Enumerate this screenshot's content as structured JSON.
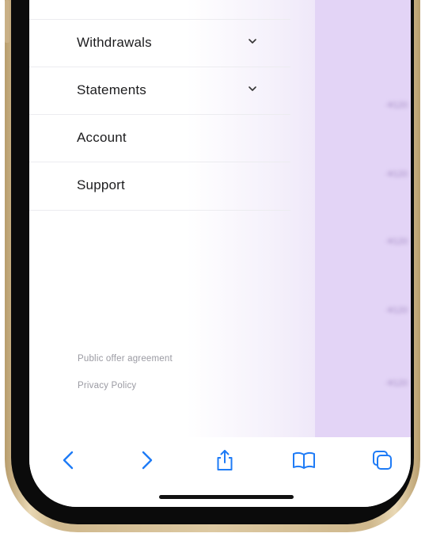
{
  "menu": {
    "items": [
      {
        "label": "Withdrawals",
        "has_submenu": true
      },
      {
        "label": "Statements",
        "has_submenu": true
      },
      {
        "label": "Account",
        "has_submenu": false
      },
      {
        "label": "Support",
        "has_submenu": false
      }
    ]
  },
  "footer": {
    "offer_link": "Public offer agreement",
    "privacy_link": "Privacy Policy"
  },
  "background": {
    "amounts": [
      "-¥120",
      "-¥120",
      "-¥120",
      "-¥120",
      "-¥120"
    ]
  },
  "toolbar": {
    "icons": [
      "back-icon",
      "forward-icon",
      "share-icon",
      "bookmarks-icon",
      "tabs-icon"
    ],
    "accent": "#1e7bf6"
  },
  "colors": {
    "background_app": "#e3d4f6",
    "phone_frame": "#d6c29c"
  }
}
